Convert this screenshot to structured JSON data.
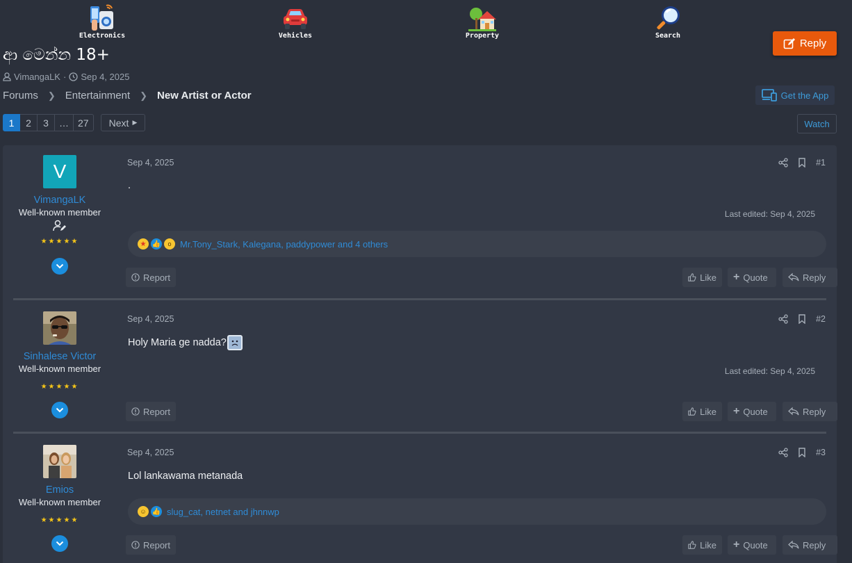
{
  "categories": [
    {
      "label": "Electronics",
      "icon": "electronics-icon"
    },
    {
      "label": "Vehicles",
      "icon": "car-icon"
    },
    {
      "label": "Property",
      "icon": "house-icon"
    },
    {
      "label": "Search",
      "icon": "magnifier-icon"
    }
  ],
  "header": {
    "reply_label": "Reply",
    "title": "ආ මෙන්න 18+",
    "author": "VimangaLK",
    "date": "Sep 4, 2025",
    "get_app": "Get the App",
    "watch": "Watch"
  },
  "breadcrumb": [
    "Forums",
    "Entertainment",
    "New Artist or Actor"
  ],
  "pagination": {
    "pages": [
      "1",
      "2",
      "3",
      "…",
      "27"
    ],
    "current": "1",
    "next": "Next"
  },
  "posts": [
    {
      "user": "VimangaLK",
      "avatar_letter": "V",
      "role": "Well-known member",
      "stars": "★★★★★",
      "date": "Sep 4, 2025",
      "number": "#1",
      "body": ".",
      "edited": "Last edited: Sep 4, 2025",
      "reactions": "Mr.Tony_Stark, Kalegana, paddypower and 4 others"
    },
    {
      "user": "Sinhalese Victor",
      "role": "Well-known member",
      "stars": "★★★★★",
      "date": "Sep 4, 2025",
      "number": "#2",
      "body": "Holy Maria ge nadda?",
      "edited": "Last edited: Sep 4, 2025"
    },
    {
      "user": "Emios",
      "role": "Well-known member",
      "stars": "★★★★★",
      "date": "Sep 4, 2025",
      "number": "#3",
      "body": "Lol lankawama metanada",
      "reactions": "slug_cat, netnet and jhnnwp"
    }
  ],
  "post_actions": {
    "report": "Report",
    "like": "Like",
    "quote": "Quote",
    "reply": "Reply"
  },
  "colors": {
    "background": "#2b303b",
    "panel": "#323845",
    "accent": "#2f8bd6",
    "reply_button": "#e8590c"
  }
}
